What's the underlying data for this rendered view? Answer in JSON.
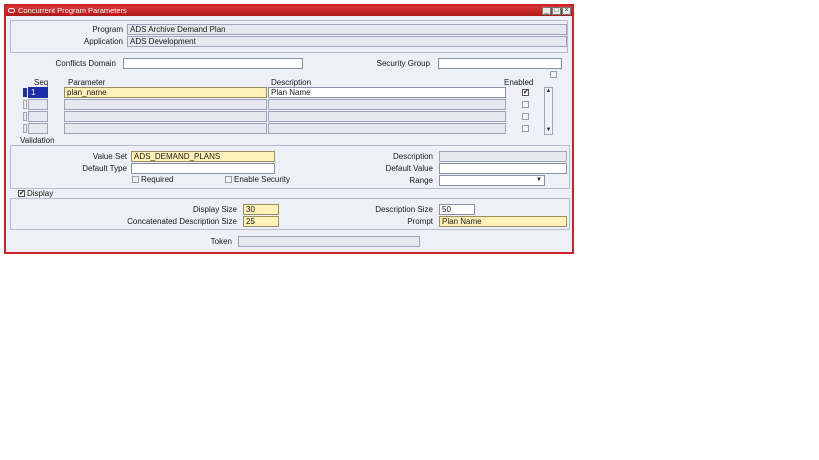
{
  "window": {
    "title": "Concurrent Program Parameters",
    "minimize": "_",
    "maximize": "□",
    "close": "×"
  },
  "header": {
    "program_label": "Program",
    "program_value": "ADS Archive Demand Plan",
    "application_label": "Application",
    "application_value": "ADS Development",
    "conflicts_label": "Conflicts Domain",
    "conflicts_value": "",
    "security_label": "Security Group",
    "security_value": ""
  },
  "grid": {
    "col_seq": "Seq",
    "col_param": "Parameter",
    "col_desc": "Description",
    "col_enabled": "Enabled",
    "rows": [
      {
        "seq": "1",
        "parameter": "plan_name",
        "description": "Plan Name",
        "enabled": true
      },
      {
        "seq": "",
        "parameter": "",
        "description": "",
        "enabled": false
      },
      {
        "seq": "",
        "parameter": "",
        "description": "",
        "enabled": false
      },
      {
        "seq": "",
        "parameter": "",
        "description": "",
        "enabled": false
      }
    ]
  },
  "validation": {
    "section": "Validation",
    "value_set_label": "Value Set",
    "value_set_value": "ADS_DEMAND_PLANS",
    "default_type_label": "Default Type",
    "default_type_value": "",
    "required_label": "Required",
    "enable_security_label": "Enable Security",
    "description_label": "Description",
    "description_value": "",
    "default_value_label": "Default Value",
    "default_value_value": "",
    "range_label": "Range",
    "range_value": ""
  },
  "display": {
    "section": "Display",
    "checked": true,
    "display_size_label": "Display Size",
    "display_size_value": "30",
    "concat_label": "Concatenated Description Size",
    "concat_value": "25",
    "desc_size_label": "Description Size",
    "desc_size_value": "50",
    "prompt_label": "Prompt",
    "prompt_value": "Plan Name"
  },
  "token": {
    "label": "Token",
    "value": ""
  },
  "icons": {
    "check": "✔",
    "scroll_up": "▲",
    "scroll_down": "▼",
    "dropdown": "▼"
  },
  "colors": {
    "title_bar": "#c42020",
    "required_field": "#fff1b8",
    "window_bg": "#eef0f8"
  }
}
